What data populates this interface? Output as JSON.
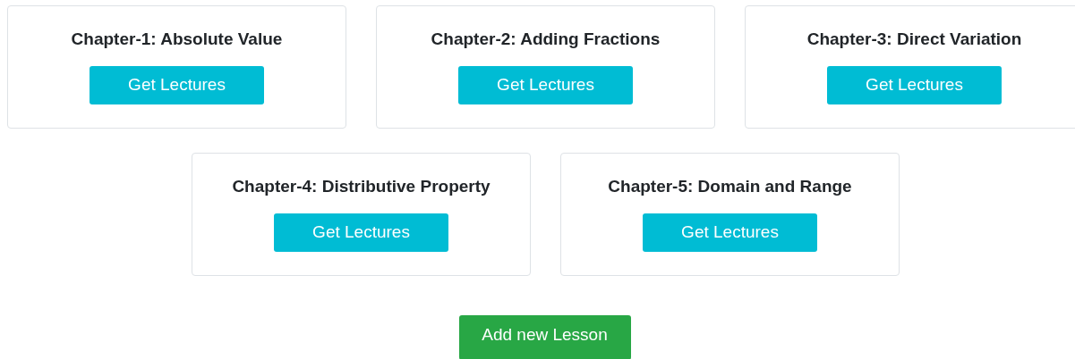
{
  "chapters": [
    {
      "title": "Chapter-1: Absolute Value",
      "button": "Get Lectures"
    },
    {
      "title": "Chapter-2: Adding Fractions",
      "button": "Get Lectures"
    },
    {
      "title": "Chapter-3: Direct Variation",
      "button": "Get Lectures"
    },
    {
      "title": "Chapter-4: Distributive Property",
      "button": "Get Lectures"
    },
    {
      "title": "Chapter-5: Domain and Range",
      "button": "Get Lectures"
    }
  ],
  "add_button": "Add new Lesson"
}
